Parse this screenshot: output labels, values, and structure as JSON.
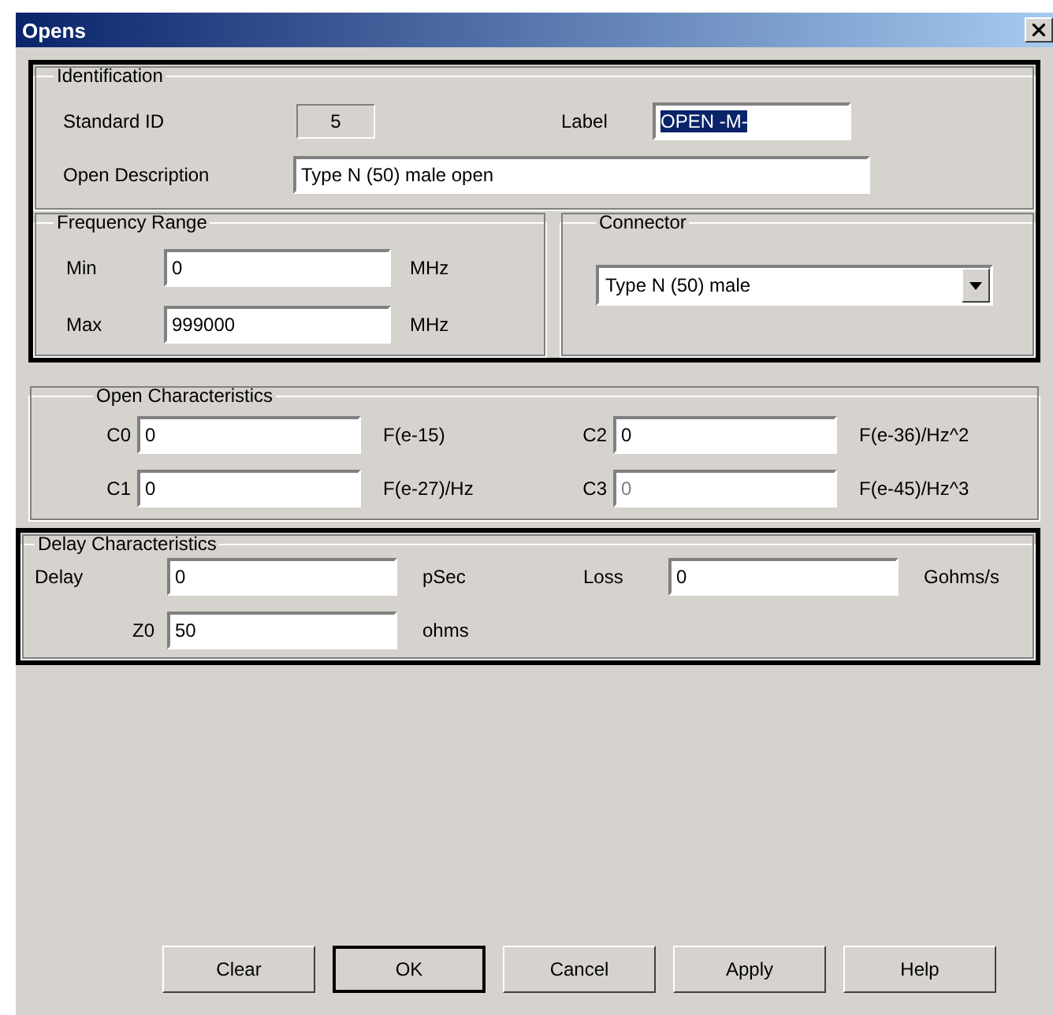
{
  "window": {
    "title": "Opens"
  },
  "identification": {
    "title": "Identification",
    "standard_id": {
      "label": "Standard ID",
      "value": "5"
    },
    "label_field": {
      "label": "Label",
      "value": "OPEN -M-",
      "text_selected": true
    },
    "description": {
      "label": "Open Description",
      "value": "Type N (50) male open"
    }
  },
  "frequency_range": {
    "title": "Frequency Range",
    "rows": [
      {
        "label": "Min",
        "value": "0",
        "unit": "MHz"
      },
      {
        "label": "Max",
        "value": "999000",
        "unit": "MHz"
      }
    ]
  },
  "connector": {
    "title": "Connector",
    "value": "Type N (50) male"
  },
  "open_characteristics": {
    "title": "Open Characteristics",
    "fields": [
      {
        "label": "C0",
        "value": "0",
        "unit": "F(e-15)",
        "disabled": false
      },
      {
        "label": "C2",
        "value": "0",
        "unit": "F(e-36)/Hz^2",
        "disabled": false
      },
      {
        "label": "C1",
        "value": "0",
        "unit": "F(e-27)/Hz",
        "disabled": false
      },
      {
        "label": "C3",
        "value": "0",
        "unit": "F(e-45)/Hz^3",
        "disabled": true
      }
    ]
  },
  "delay_characteristics": {
    "title": "Delay Characteristics",
    "fields": [
      {
        "label": "Delay",
        "value": "0",
        "unit": "pSec"
      },
      {
        "label": "Loss",
        "value": "0",
        "unit": "Gohms/s"
      },
      {
        "label": "Z0",
        "value": "50",
        "unit": "ohms"
      }
    ]
  },
  "buttons": [
    {
      "label": "Clear",
      "default": false
    },
    {
      "label": "OK",
      "default": true
    },
    {
      "label": "Cancel",
      "default": false
    },
    {
      "label": "Apply",
      "default": false
    },
    {
      "label": "Help",
      "default": false
    }
  ]
}
